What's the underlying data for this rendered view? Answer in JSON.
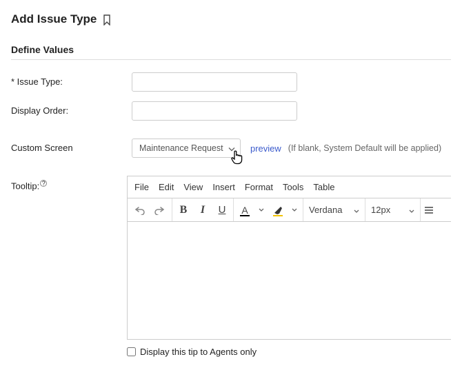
{
  "title": "Add Issue Type",
  "section_heading": "Define Values",
  "labels": {
    "issue_type": "* Issue Type:",
    "display_order": "Display Order:",
    "custom_screen": "Custom Screen",
    "tooltip": "Tooltip:"
  },
  "fields": {
    "issue_type_value": "",
    "display_order_value": "",
    "custom_screen_value": "Maintenance Request",
    "agents_only_checked": false
  },
  "custom_screen": {
    "preview_link": "preview",
    "hint": "(If blank, System Default will be applied)"
  },
  "editor": {
    "menus": [
      "File",
      "Edit",
      "View",
      "Insert",
      "Format",
      "Tools",
      "Table"
    ],
    "font_family": "Verdana",
    "font_size": "12px"
  },
  "agents_only_label": "Display this tip to Agents only"
}
